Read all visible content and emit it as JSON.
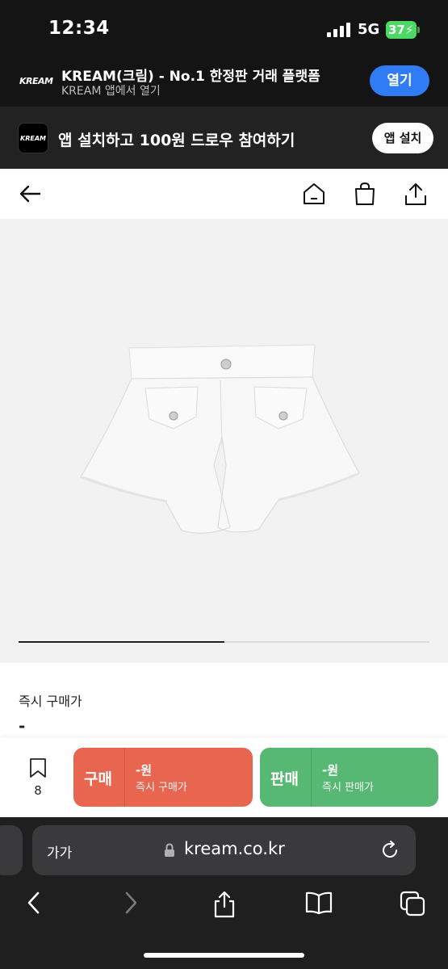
{
  "status_bar": {
    "time": "12:34",
    "network": "5G",
    "battery": "37"
  },
  "app_banner": {
    "logo": "KREAM",
    "title": "KREAM(크림) - No.1 한정판 거래 플랫폼",
    "subtitle": "KREAM 앱에서 열기",
    "open_label": "열기"
  },
  "install_bar": {
    "logo": "KREAM",
    "text": "앱 설치하고 100원 드로우 참여하기",
    "button_label": "앱 설치"
  },
  "header": {
    "icons": [
      "back-arrow-icon",
      "home-icon",
      "shopping-bag-icon",
      "share-icon"
    ]
  },
  "product": {
    "image": "white-denim-shorts",
    "gallery_progress": 0.5
  },
  "price_section": {
    "label": "즉시 구매가",
    "value": "-"
  },
  "action_bar": {
    "wish_count": "8",
    "buy": {
      "label": "구매",
      "price": "-원",
      "sub": "즉시 구매가",
      "color": "#e8654f"
    },
    "sell": {
      "label": "판매",
      "price": "-원",
      "sub": "즉시 판매가",
      "color": "#57b873"
    }
  },
  "safari": {
    "aa_label": "가가",
    "url": "kream.co.kr",
    "toolbar": [
      "back-icon",
      "forward-icon",
      "share-icon",
      "bookmarks-icon",
      "tabs-icon"
    ]
  }
}
